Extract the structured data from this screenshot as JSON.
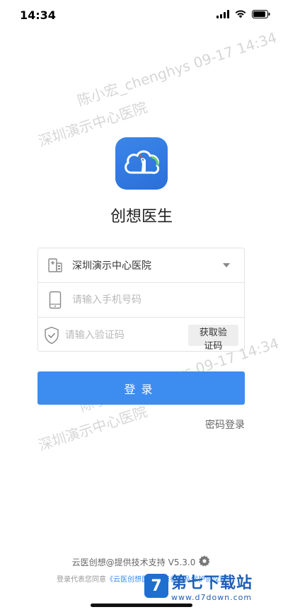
{
  "status_bar": {
    "time": "14:34"
  },
  "watermark": {
    "line1": "陈小宏_chenghys  09-17 14:34",
    "line2": "深圳演示中心医院"
  },
  "app": {
    "name": "创想医生",
    "brand_color": "#3d8cf0"
  },
  "form": {
    "hospital": "深圳演示中心医院",
    "phone_placeholder": "请输入手机号码",
    "code_placeholder": "请输入验证码",
    "get_code_label": "获取验证码"
  },
  "login_label": "登录",
  "password_login_label": "密码登录",
  "footer": {
    "support_text": "云医创想@提供技术支持",
    "version": "V5.3.0",
    "agreement_prefix": "登录代表您同意",
    "agreement_link": "《云医创想医生及患者隐私保护协议》"
  },
  "site_badge": {
    "logo_letter": "7",
    "name": "第七下载站",
    "url": "www.d7down.com"
  }
}
